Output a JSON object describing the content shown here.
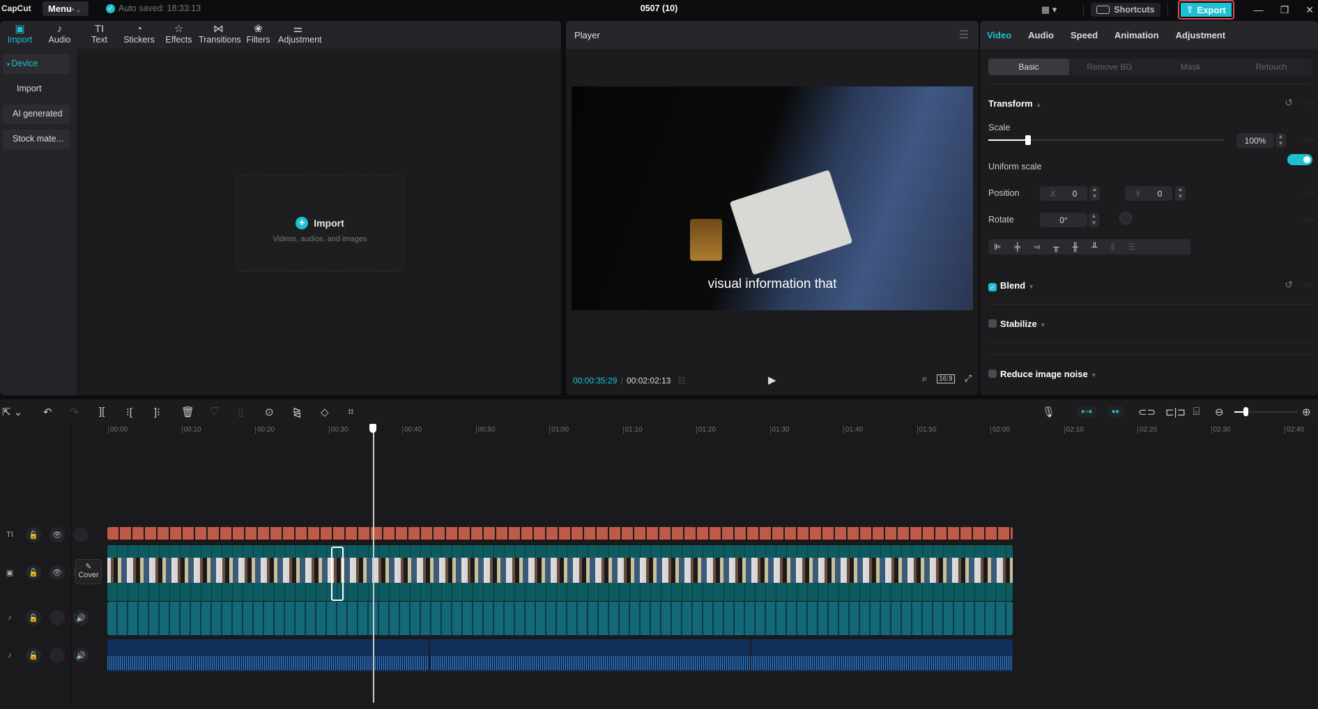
{
  "app": {
    "logo": "CapCut",
    "menu_label": "Menu",
    "autosave": "Auto saved: 18:33:13",
    "project_title": "0507 (10)",
    "shortcuts_label": "Shortcuts",
    "export_label": "Export"
  },
  "media_tools": [
    {
      "label": "Import",
      "icon": "import-icon",
      "glyph": "▣",
      "active": true
    },
    {
      "label": "Audio",
      "icon": "audio-icon",
      "glyph": "♪"
    },
    {
      "label": "Text",
      "icon": "text-icon",
      "glyph": "TI"
    },
    {
      "label": "Stickers",
      "icon": "sticker-icon",
      "glyph": "◔"
    },
    {
      "label": "Effects",
      "icon": "effects-icon",
      "glyph": "☆"
    },
    {
      "label": "Transitions",
      "icon": "transitions-icon",
      "glyph": "⋈"
    },
    {
      "label": "Filters",
      "icon": "filters-icon",
      "glyph": "❀"
    },
    {
      "label": "Adjustment",
      "icon": "adjustment-icon",
      "glyph": "⚌"
    }
  ],
  "sidebar": {
    "items": [
      {
        "label": "Device",
        "active": true
      },
      {
        "label": "Import"
      },
      {
        "label": "AI generated"
      },
      {
        "label": "Stock mate..."
      }
    ]
  },
  "dropzone": {
    "title": "Import",
    "subtitle": "Videos, audios, and images"
  },
  "player": {
    "title": "Player",
    "caption": "visual information that",
    "current_time": "00:00:35:29",
    "total_time": "00:02:02:13",
    "ratio": "16:9"
  },
  "inspector": {
    "tabs": [
      "Video",
      "Audio",
      "Speed",
      "Animation",
      "Adjustment"
    ],
    "active_tab": "Video",
    "subtabs": [
      "Basic",
      "Remove BG",
      "Mask",
      "Retouch"
    ],
    "transform_label": "Transform",
    "scale_label": "Scale",
    "scale_value": "100%",
    "scale_slider_fraction": 0.17,
    "uniform_scale_label": "Uniform scale",
    "uniform_scale_on": true,
    "position_label": "Position",
    "x_label": "X",
    "x_value": "0",
    "y_label": "Y",
    "y_value": "0",
    "rotate_label": "Rotate",
    "rotate_value": "0°",
    "blend_label": "Blend",
    "blend_checked": true,
    "stabilize_label": "Stabilize",
    "stabilize_checked": false,
    "noise_label": "Reduce image noise",
    "noise_checked": false
  },
  "timeline": {
    "ruler_ticks": [
      "00:00",
      "00:10",
      "00:20",
      "00:30",
      "00:40",
      "00:50",
      "01:00",
      "01:10",
      "01:20",
      "01:30",
      "01:40",
      "01:50",
      "02:00",
      "02:10",
      "02:20",
      "02:30",
      "02:40"
    ],
    "cover_label": "Cover",
    "zoom_fraction": 0.18
  }
}
